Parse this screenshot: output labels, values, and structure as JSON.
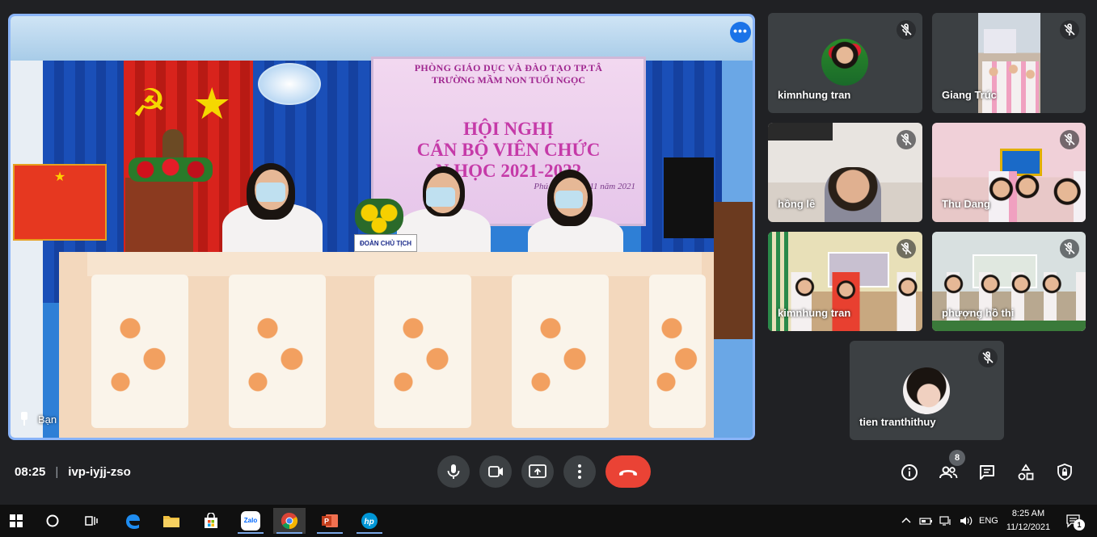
{
  "main_video": {
    "participant_name": "Bạn",
    "screen_text": {
      "line1": "PHÒNG GIÁO DỤC VÀ ĐÀO TẠO TP.TÂ",
      "line2": "TRƯỜNG MẦM NON TUỔI NGỌC",
      "line3": "HỘI NGHỊ",
      "line4": "CÁN BỘ VIÊN CHỨC",
      "line5": "N  HỌC 2021-2022",
      "line6": "Phú Hòa, ngày       11 năm 2021"
    },
    "nameplate": "ĐOÀN CHỦ TỊCH",
    "more_options_label": "•••"
  },
  "participants": [
    {
      "name": "kimnhung tran",
      "muted": true
    },
    {
      "name": "Giang Trúc",
      "muted": true
    },
    {
      "name": "hồng lê",
      "muted": true
    },
    {
      "name": "Thu Dang",
      "muted": true
    },
    {
      "name": "kimnhung tran",
      "muted": true
    },
    {
      "name": "phượng hồ thị",
      "muted": true
    },
    {
      "name": "tien tranthithuy",
      "muted": true
    }
  ],
  "meeting": {
    "time": "08:25",
    "separator": "|",
    "code": "ivp-iyjj-zso"
  },
  "controls": [
    "microphone",
    "camera",
    "present-screen",
    "more-options",
    "end-call"
  ],
  "right_controls": {
    "people_count": "8",
    "items": [
      "info",
      "people",
      "chat",
      "activities",
      "host-controls"
    ]
  },
  "taskbar": {
    "apps": [
      "start",
      "search",
      "task-view",
      "edge",
      "file-explorer",
      "store",
      "zalo",
      "chrome",
      "powerpoint",
      "hp"
    ],
    "zalo_label": "Zalo",
    "language": "ENG",
    "time": "8:25 AM",
    "date": "11/12/2021",
    "notification_count": "1"
  },
  "colors": {
    "background": "#202124",
    "active_speaker_border": "#8ab4f8",
    "end_call": "#ea4335",
    "control_button": "#3c4043"
  }
}
